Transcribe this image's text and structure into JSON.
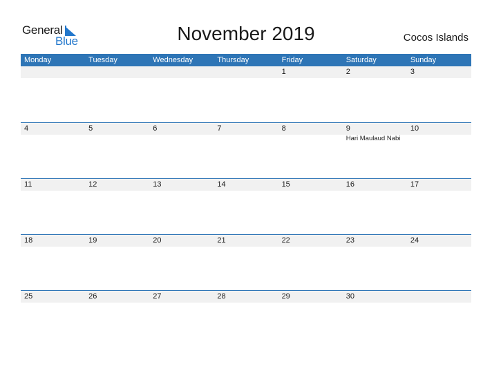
{
  "logo": {
    "line1": "General",
    "line2": "Blue"
  },
  "title": "November 2019",
  "country": "Cocos Islands",
  "colors": {
    "header_bg": "#2e75b6",
    "band_bg": "#f1f1f1",
    "logo_blue": "#2277cc"
  },
  "weekdays": [
    "Monday",
    "Tuesday",
    "Wednesday",
    "Thursday",
    "Friday",
    "Saturday",
    "Sunday"
  ],
  "weeks": [
    {
      "days": [
        {
          "num": "",
          "holiday": ""
        },
        {
          "num": "",
          "holiday": ""
        },
        {
          "num": "",
          "holiday": ""
        },
        {
          "num": "",
          "holiday": ""
        },
        {
          "num": "1",
          "holiday": ""
        },
        {
          "num": "2",
          "holiday": ""
        },
        {
          "num": "3",
          "holiday": ""
        }
      ]
    },
    {
      "days": [
        {
          "num": "4",
          "holiday": ""
        },
        {
          "num": "5",
          "holiday": ""
        },
        {
          "num": "6",
          "holiday": ""
        },
        {
          "num": "7",
          "holiday": ""
        },
        {
          "num": "8",
          "holiday": ""
        },
        {
          "num": "9",
          "holiday": "Hari Maulaud Nabi"
        },
        {
          "num": "10",
          "holiday": ""
        }
      ]
    },
    {
      "days": [
        {
          "num": "11",
          "holiday": ""
        },
        {
          "num": "12",
          "holiday": ""
        },
        {
          "num": "13",
          "holiday": ""
        },
        {
          "num": "14",
          "holiday": ""
        },
        {
          "num": "15",
          "holiday": ""
        },
        {
          "num": "16",
          "holiday": ""
        },
        {
          "num": "17",
          "holiday": ""
        }
      ]
    },
    {
      "days": [
        {
          "num": "18",
          "holiday": ""
        },
        {
          "num": "19",
          "holiday": ""
        },
        {
          "num": "20",
          "holiday": ""
        },
        {
          "num": "21",
          "holiday": ""
        },
        {
          "num": "22",
          "holiday": ""
        },
        {
          "num": "23",
          "holiday": ""
        },
        {
          "num": "24",
          "holiday": ""
        }
      ]
    },
    {
      "days": [
        {
          "num": "25",
          "holiday": ""
        },
        {
          "num": "26",
          "holiday": ""
        },
        {
          "num": "27",
          "holiday": ""
        },
        {
          "num": "28",
          "holiday": ""
        },
        {
          "num": "29",
          "holiday": ""
        },
        {
          "num": "30",
          "holiday": ""
        },
        {
          "num": "",
          "holiday": ""
        }
      ]
    }
  ]
}
